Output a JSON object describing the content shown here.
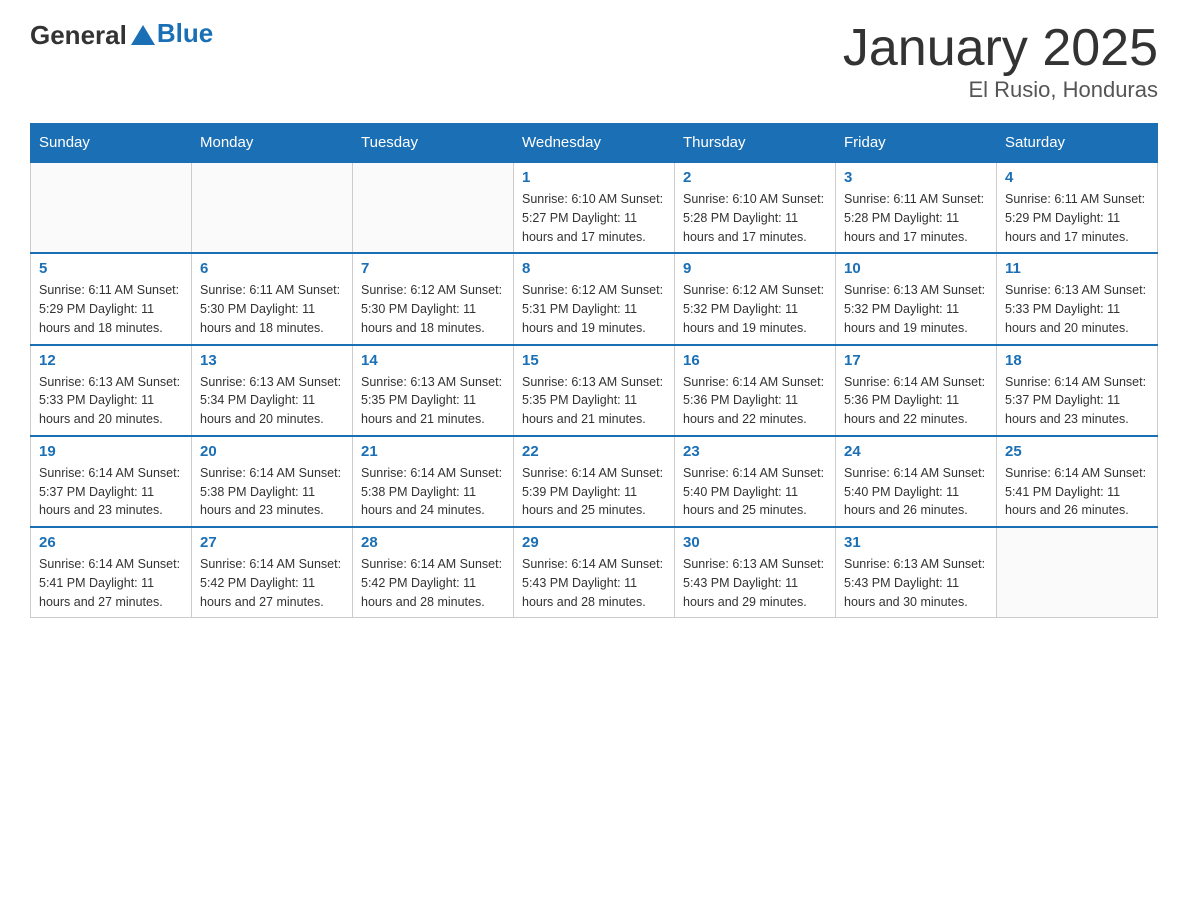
{
  "logo": {
    "general": "General",
    "triangle": "▲",
    "blue": "Blue"
  },
  "title": "January 2025",
  "subtitle": "El Rusio, Honduras",
  "headers": [
    "Sunday",
    "Monday",
    "Tuesday",
    "Wednesday",
    "Thursday",
    "Friday",
    "Saturday"
  ],
  "weeks": [
    [
      {
        "day": "",
        "info": ""
      },
      {
        "day": "",
        "info": ""
      },
      {
        "day": "",
        "info": ""
      },
      {
        "day": "1",
        "info": "Sunrise: 6:10 AM\nSunset: 5:27 PM\nDaylight: 11 hours and 17 minutes."
      },
      {
        "day": "2",
        "info": "Sunrise: 6:10 AM\nSunset: 5:28 PM\nDaylight: 11 hours and 17 minutes."
      },
      {
        "day": "3",
        "info": "Sunrise: 6:11 AM\nSunset: 5:28 PM\nDaylight: 11 hours and 17 minutes."
      },
      {
        "day": "4",
        "info": "Sunrise: 6:11 AM\nSunset: 5:29 PM\nDaylight: 11 hours and 17 minutes."
      }
    ],
    [
      {
        "day": "5",
        "info": "Sunrise: 6:11 AM\nSunset: 5:29 PM\nDaylight: 11 hours and 18 minutes."
      },
      {
        "day": "6",
        "info": "Sunrise: 6:11 AM\nSunset: 5:30 PM\nDaylight: 11 hours and 18 minutes."
      },
      {
        "day": "7",
        "info": "Sunrise: 6:12 AM\nSunset: 5:30 PM\nDaylight: 11 hours and 18 minutes."
      },
      {
        "day": "8",
        "info": "Sunrise: 6:12 AM\nSunset: 5:31 PM\nDaylight: 11 hours and 19 minutes."
      },
      {
        "day": "9",
        "info": "Sunrise: 6:12 AM\nSunset: 5:32 PM\nDaylight: 11 hours and 19 minutes."
      },
      {
        "day": "10",
        "info": "Sunrise: 6:13 AM\nSunset: 5:32 PM\nDaylight: 11 hours and 19 minutes."
      },
      {
        "day": "11",
        "info": "Sunrise: 6:13 AM\nSunset: 5:33 PM\nDaylight: 11 hours and 20 minutes."
      }
    ],
    [
      {
        "day": "12",
        "info": "Sunrise: 6:13 AM\nSunset: 5:33 PM\nDaylight: 11 hours and 20 minutes."
      },
      {
        "day": "13",
        "info": "Sunrise: 6:13 AM\nSunset: 5:34 PM\nDaylight: 11 hours and 20 minutes."
      },
      {
        "day": "14",
        "info": "Sunrise: 6:13 AM\nSunset: 5:35 PM\nDaylight: 11 hours and 21 minutes."
      },
      {
        "day": "15",
        "info": "Sunrise: 6:13 AM\nSunset: 5:35 PM\nDaylight: 11 hours and 21 minutes."
      },
      {
        "day": "16",
        "info": "Sunrise: 6:14 AM\nSunset: 5:36 PM\nDaylight: 11 hours and 22 minutes."
      },
      {
        "day": "17",
        "info": "Sunrise: 6:14 AM\nSunset: 5:36 PM\nDaylight: 11 hours and 22 minutes."
      },
      {
        "day": "18",
        "info": "Sunrise: 6:14 AM\nSunset: 5:37 PM\nDaylight: 11 hours and 23 minutes."
      }
    ],
    [
      {
        "day": "19",
        "info": "Sunrise: 6:14 AM\nSunset: 5:37 PM\nDaylight: 11 hours and 23 minutes."
      },
      {
        "day": "20",
        "info": "Sunrise: 6:14 AM\nSunset: 5:38 PM\nDaylight: 11 hours and 23 minutes."
      },
      {
        "day": "21",
        "info": "Sunrise: 6:14 AM\nSunset: 5:38 PM\nDaylight: 11 hours and 24 minutes."
      },
      {
        "day": "22",
        "info": "Sunrise: 6:14 AM\nSunset: 5:39 PM\nDaylight: 11 hours and 25 minutes."
      },
      {
        "day": "23",
        "info": "Sunrise: 6:14 AM\nSunset: 5:40 PM\nDaylight: 11 hours and 25 minutes."
      },
      {
        "day": "24",
        "info": "Sunrise: 6:14 AM\nSunset: 5:40 PM\nDaylight: 11 hours and 26 minutes."
      },
      {
        "day": "25",
        "info": "Sunrise: 6:14 AM\nSunset: 5:41 PM\nDaylight: 11 hours and 26 minutes."
      }
    ],
    [
      {
        "day": "26",
        "info": "Sunrise: 6:14 AM\nSunset: 5:41 PM\nDaylight: 11 hours and 27 minutes."
      },
      {
        "day": "27",
        "info": "Sunrise: 6:14 AM\nSunset: 5:42 PM\nDaylight: 11 hours and 27 minutes."
      },
      {
        "day": "28",
        "info": "Sunrise: 6:14 AM\nSunset: 5:42 PM\nDaylight: 11 hours and 28 minutes."
      },
      {
        "day": "29",
        "info": "Sunrise: 6:14 AM\nSunset: 5:43 PM\nDaylight: 11 hours and 28 minutes."
      },
      {
        "day": "30",
        "info": "Sunrise: 6:13 AM\nSunset: 5:43 PM\nDaylight: 11 hours and 29 minutes."
      },
      {
        "day": "31",
        "info": "Sunrise: 6:13 AM\nSunset: 5:43 PM\nDaylight: 11 hours and 30 minutes."
      },
      {
        "day": "",
        "info": ""
      }
    ]
  ]
}
